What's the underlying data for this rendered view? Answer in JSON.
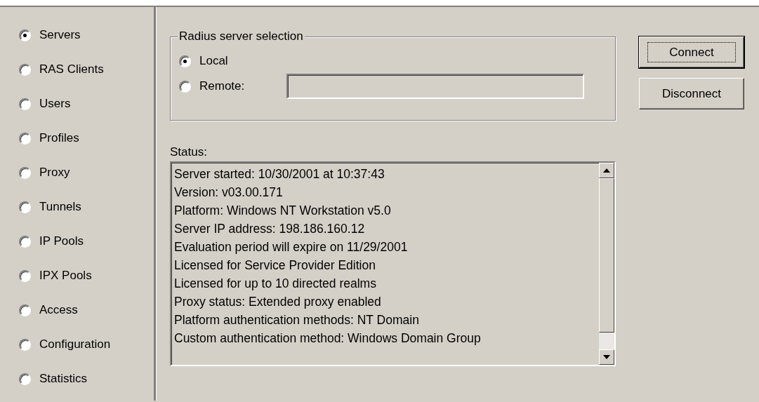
{
  "sidebar": {
    "items": [
      {
        "label": "Servers",
        "selected": true
      },
      {
        "label": "RAS Clients",
        "selected": false
      },
      {
        "label": "Users",
        "selected": false
      },
      {
        "label": "Profiles",
        "selected": false
      },
      {
        "label": "Proxy",
        "selected": false
      },
      {
        "label": "Tunnels",
        "selected": false
      },
      {
        "label": "IP Pools",
        "selected": false
      },
      {
        "label": "IPX Pools",
        "selected": false
      },
      {
        "label": "Access",
        "selected": false
      },
      {
        "label": "Configuration",
        "selected": false
      },
      {
        "label": "Statistics",
        "selected": false
      }
    ]
  },
  "server_selection": {
    "title": "Radius server selection",
    "options": [
      {
        "label": "Local",
        "selected": true
      },
      {
        "label": "Remote:",
        "selected": false
      }
    ]
  },
  "buttons": [
    {
      "label": "Connect",
      "default": true
    },
    {
      "label": "Disconnect",
      "default": false
    }
  ],
  "status": {
    "label": "Status:",
    "lines": [
      "Server started: 10/30/2001 at 10:37:43",
      "Version: v03.00.171",
      "Platform: Windows NT Workstation v5.0",
      "Server IP address: 198.186.160.12",
      "Evaluation period will expire on 11/29/2001",
      "Licensed for Service Provider Edition",
      "Licensed for up to 10 directed realms",
      "Proxy status: Extended proxy enabled",
      "Platform authentication methods: NT Domain",
      "Custom authentication method: Windows Domain Group"
    ]
  }
}
